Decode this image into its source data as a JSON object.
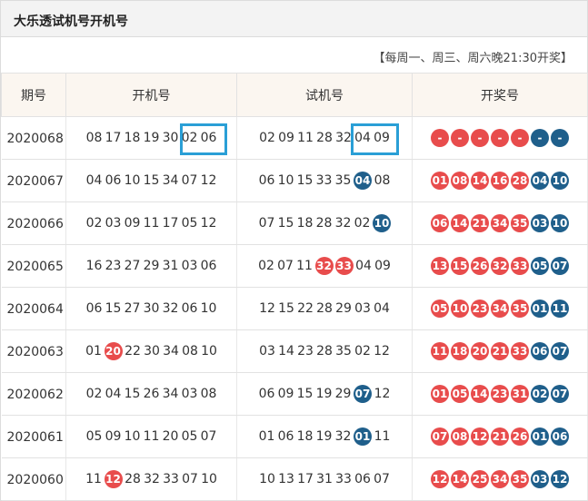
{
  "title": "大乐透试机号开机号",
  "schedule": "【每周一、周三、周六晚21:30开奖】",
  "headers": {
    "period": "期号",
    "open": "开机号",
    "trial": "试机号",
    "draw": "开奖号"
  },
  "colors": {
    "red": "#e84c4c",
    "blue": "#1f5f8b",
    "highlight": "#2a9fd6"
  },
  "rows": [
    {
      "period": "2020068",
      "open": [
        {
          "v": "08"
        },
        {
          "v": "17"
        },
        {
          "v": "18"
        },
        {
          "v": "19"
        },
        {
          "v": "30"
        },
        {
          "v": "02"
        },
        {
          "v": "06"
        }
      ],
      "trial": [
        {
          "v": "02"
        },
        {
          "v": "09"
        },
        {
          "v": "11"
        },
        {
          "v": "28"
        },
        {
          "v": "32"
        },
        {
          "v": "04"
        },
        {
          "v": "09"
        }
      ],
      "draw": [
        {
          "v": "-",
          "c": "red"
        },
        {
          "v": "-",
          "c": "red"
        },
        {
          "v": "-",
          "c": "red"
        },
        {
          "v": "-",
          "c": "red"
        },
        {
          "v": "-",
          "c": "red"
        },
        {
          "v": "-",
          "c": "blue"
        },
        {
          "v": "-",
          "c": "blue"
        }
      ]
    },
    {
      "period": "2020067",
      "open": [
        {
          "v": "04"
        },
        {
          "v": "06"
        },
        {
          "v": "10"
        },
        {
          "v": "15"
        },
        {
          "v": "34"
        },
        {
          "v": "07"
        },
        {
          "v": "12"
        }
      ],
      "trial": [
        {
          "v": "06"
        },
        {
          "v": "10"
        },
        {
          "v": "15"
        },
        {
          "v": "33"
        },
        {
          "v": "35"
        },
        {
          "v": "04",
          "c": "blue"
        },
        {
          "v": "08"
        }
      ],
      "draw": [
        {
          "v": "01",
          "c": "red"
        },
        {
          "v": "08",
          "c": "red"
        },
        {
          "v": "14",
          "c": "red"
        },
        {
          "v": "16",
          "c": "red"
        },
        {
          "v": "28",
          "c": "red"
        },
        {
          "v": "04",
          "c": "blue"
        },
        {
          "v": "10",
          "c": "blue"
        }
      ]
    },
    {
      "period": "2020066",
      "open": [
        {
          "v": "02"
        },
        {
          "v": "03"
        },
        {
          "v": "09"
        },
        {
          "v": "11"
        },
        {
          "v": "17"
        },
        {
          "v": "05"
        },
        {
          "v": "12"
        }
      ],
      "trial": [
        {
          "v": "07"
        },
        {
          "v": "15"
        },
        {
          "v": "18"
        },
        {
          "v": "28"
        },
        {
          "v": "32"
        },
        {
          "v": "02"
        },
        {
          "v": "10",
          "c": "blue"
        }
      ],
      "draw": [
        {
          "v": "06",
          "c": "red"
        },
        {
          "v": "14",
          "c": "red"
        },
        {
          "v": "21",
          "c": "red"
        },
        {
          "v": "34",
          "c": "red"
        },
        {
          "v": "35",
          "c": "red"
        },
        {
          "v": "03",
          "c": "blue"
        },
        {
          "v": "10",
          "c": "blue"
        }
      ]
    },
    {
      "period": "2020065",
      "open": [
        {
          "v": "16"
        },
        {
          "v": "23"
        },
        {
          "v": "27"
        },
        {
          "v": "29"
        },
        {
          "v": "31"
        },
        {
          "v": "03"
        },
        {
          "v": "06"
        }
      ],
      "trial": [
        {
          "v": "02"
        },
        {
          "v": "07"
        },
        {
          "v": "11"
        },
        {
          "v": "32",
          "c": "red"
        },
        {
          "v": "33",
          "c": "red"
        },
        {
          "v": "04"
        },
        {
          "v": "09"
        }
      ],
      "draw": [
        {
          "v": "13",
          "c": "red"
        },
        {
          "v": "15",
          "c": "red"
        },
        {
          "v": "26",
          "c": "red"
        },
        {
          "v": "32",
          "c": "red"
        },
        {
          "v": "33",
          "c": "red"
        },
        {
          "v": "05",
          "c": "blue"
        },
        {
          "v": "07",
          "c": "blue"
        }
      ]
    },
    {
      "period": "2020064",
      "open": [
        {
          "v": "06"
        },
        {
          "v": "15"
        },
        {
          "v": "27"
        },
        {
          "v": "30"
        },
        {
          "v": "32"
        },
        {
          "v": "06"
        },
        {
          "v": "10"
        }
      ],
      "trial": [
        {
          "v": "12"
        },
        {
          "v": "15"
        },
        {
          "v": "22"
        },
        {
          "v": "28"
        },
        {
          "v": "29"
        },
        {
          "v": "03"
        },
        {
          "v": "04"
        }
      ],
      "draw": [
        {
          "v": "05",
          "c": "red"
        },
        {
          "v": "10",
          "c": "red"
        },
        {
          "v": "23",
          "c": "red"
        },
        {
          "v": "34",
          "c": "red"
        },
        {
          "v": "35",
          "c": "red"
        },
        {
          "v": "01",
          "c": "blue"
        },
        {
          "v": "11",
          "c": "blue"
        }
      ]
    },
    {
      "period": "2020063",
      "open": [
        {
          "v": "01"
        },
        {
          "v": "20",
          "c": "red"
        },
        {
          "v": "22"
        },
        {
          "v": "30"
        },
        {
          "v": "34"
        },
        {
          "v": "08"
        },
        {
          "v": "10"
        }
      ],
      "trial": [
        {
          "v": "03"
        },
        {
          "v": "14"
        },
        {
          "v": "23"
        },
        {
          "v": "28"
        },
        {
          "v": "35"
        },
        {
          "v": "02"
        },
        {
          "v": "12"
        }
      ],
      "draw": [
        {
          "v": "11",
          "c": "red"
        },
        {
          "v": "18",
          "c": "red"
        },
        {
          "v": "20",
          "c": "red"
        },
        {
          "v": "21",
          "c": "red"
        },
        {
          "v": "33",
          "c": "red"
        },
        {
          "v": "06",
          "c": "blue"
        },
        {
          "v": "07",
          "c": "blue"
        }
      ]
    },
    {
      "period": "2020062",
      "open": [
        {
          "v": "02"
        },
        {
          "v": "04"
        },
        {
          "v": "15"
        },
        {
          "v": "26"
        },
        {
          "v": "34"
        },
        {
          "v": "03"
        },
        {
          "v": "08"
        }
      ],
      "trial": [
        {
          "v": "06"
        },
        {
          "v": "09"
        },
        {
          "v": "15"
        },
        {
          "v": "19"
        },
        {
          "v": "29"
        },
        {
          "v": "07",
          "c": "blue"
        },
        {
          "v": "12"
        }
      ],
      "draw": [
        {
          "v": "01",
          "c": "red"
        },
        {
          "v": "05",
          "c": "red"
        },
        {
          "v": "14",
          "c": "red"
        },
        {
          "v": "23",
          "c": "red"
        },
        {
          "v": "31",
          "c": "red"
        },
        {
          "v": "02",
          "c": "blue"
        },
        {
          "v": "07",
          "c": "blue"
        }
      ]
    },
    {
      "period": "2020061",
      "open": [
        {
          "v": "05"
        },
        {
          "v": "09"
        },
        {
          "v": "10"
        },
        {
          "v": "11"
        },
        {
          "v": "20"
        },
        {
          "v": "05"
        },
        {
          "v": "07"
        }
      ],
      "trial": [
        {
          "v": "01"
        },
        {
          "v": "06"
        },
        {
          "v": "18"
        },
        {
          "v": "19"
        },
        {
          "v": "32"
        },
        {
          "v": "01",
          "c": "blue"
        },
        {
          "v": "11"
        }
      ],
      "draw": [
        {
          "v": "07",
          "c": "red"
        },
        {
          "v": "08",
          "c": "red"
        },
        {
          "v": "12",
          "c": "red"
        },
        {
          "v": "21",
          "c": "red"
        },
        {
          "v": "26",
          "c": "red"
        },
        {
          "v": "01",
          "c": "blue"
        },
        {
          "v": "06",
          "c": "blue"
        }
      ]
    },
    {
      "period": "2020060",
      "open": [
        {
          "v": "11"
        },
        {
          "v": "12",
          "c": "red"
        },
        {
          "v": "28"
        },
        {
          "v": "32"
        },
        {
          "v": "33"
        },
        {
          "v": "07"
        },
        {
          "v": "10"
        }
      ],
      "trial": [
        {
          "v": "10"
        },
        {
          "v": "13"
        },
        {
          "v": "17"
        },
        {
          "v": "31"
        },
        {
          "v": "33"
        },
        {
          "v": "06"
        },
        {
          "v": "07"
        }
      ],
      "draw": [
        {
          "v": "12",
          "c": "red"
        },
        {
          "v": "14",
          "c": "red"
        },
        {
          "v": "25",
          "c": "red"
        },
        {
          "v": "34",
          "c": "red"
        },
        {
          "v": "35",
          "c": "red"
        },
        {
          "v": "03",
          "c": "blue"
        },
        {
          "v": "12",
          "c": "blue"
        }
      ]
    }
  ]
}
